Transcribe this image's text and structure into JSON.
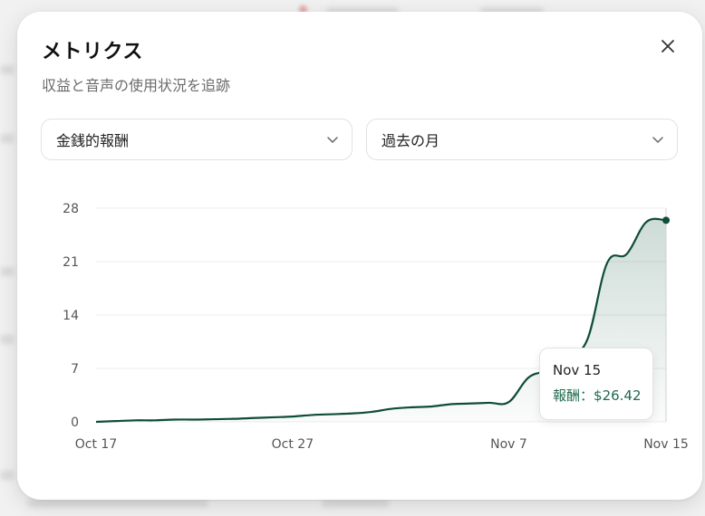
{
  "modal": {
    "title": "メトリクス",
    "subtitle": "収益と音声の使用状況を追跡",
    "close_icon": "close-icon"
  },
  "filters": {
    "metric": {
      "value": "金銭的報酬",
      "icon": "chevron-down-icon"
    },
    "range": {
      "value": "過去の月",
      "icon": "chevron-down-icon"
    }
  },
  "tooltip": {
    "date": "Nov 15",
    "label": "報酬",
    "separator": "：",
    "value": "$26.42"
  },
  "colors": {
    "line": "#0f4d38",
    "fill_top": "#1e5e4a",
    "tooltip_value": "#1e6b4e",
    "grid": "#ececec",
    "tick": "#555555"
  },
  "chart_data": {
    "type": "area",
    "ylim": [
      0,
      28
    ],
    "yticks": [
      "0",
      "7",
      "14",
      "21",
      "28"
    ],
    "xticks": [
      {
        "label": "Oct 17",
        "day": 0
      },
      {
        "label": "Oct 27",
        "day": 10
      },
      {
        "label": "Nov 7",
        "day": 21
      },
      {
        "label": "Nov 15",
        "day": 29
      }
    ],
    "grid": true,
    "series": [
      {
        "x": [
          "Oct 17",
          "Oct 18",
          "Oct 19",
          "Oct 20",
          "Oct 21",
          "Oct 22",
          "Oct 23",
          "Oct 24",
          "Oct 25",
          "Oct 26",
          "Oct 27",
          "Oct 28",
          "Oct 29",
          "Oct 30",
          "Oct 31",
          "Nov 1",
          "Nov 2",
          "Nov 3",
          "Nov 4",
          "Nov 5",
          "Nov 6",
          "Nov 7",
          "Nov 8",
          "Nov 9",
          "Nov 10",
          "Nov 11",
          "Nov 12",
          "Nov 13",
          "Nov 14",
          "Nov 15"
        ],
        "values": [
          0,
          0.1,
          0.2,
          0.2,
          0.3,
          0.3,
          0.35,
          0.4,
          0.5,
          0.6,
          0.7,
          0.9,
          1.0,
          1.1,
          1.3,
          1.7,
          1.9,
          2.0,
          2.3,
          2.4,
          2.5,
          2.6,
          5.8,
          6.8,
          8.5,
          10.8,
          20.8,
          22.0,
          26.2,
          26.42
        ]
      }
    ]
  }
}
